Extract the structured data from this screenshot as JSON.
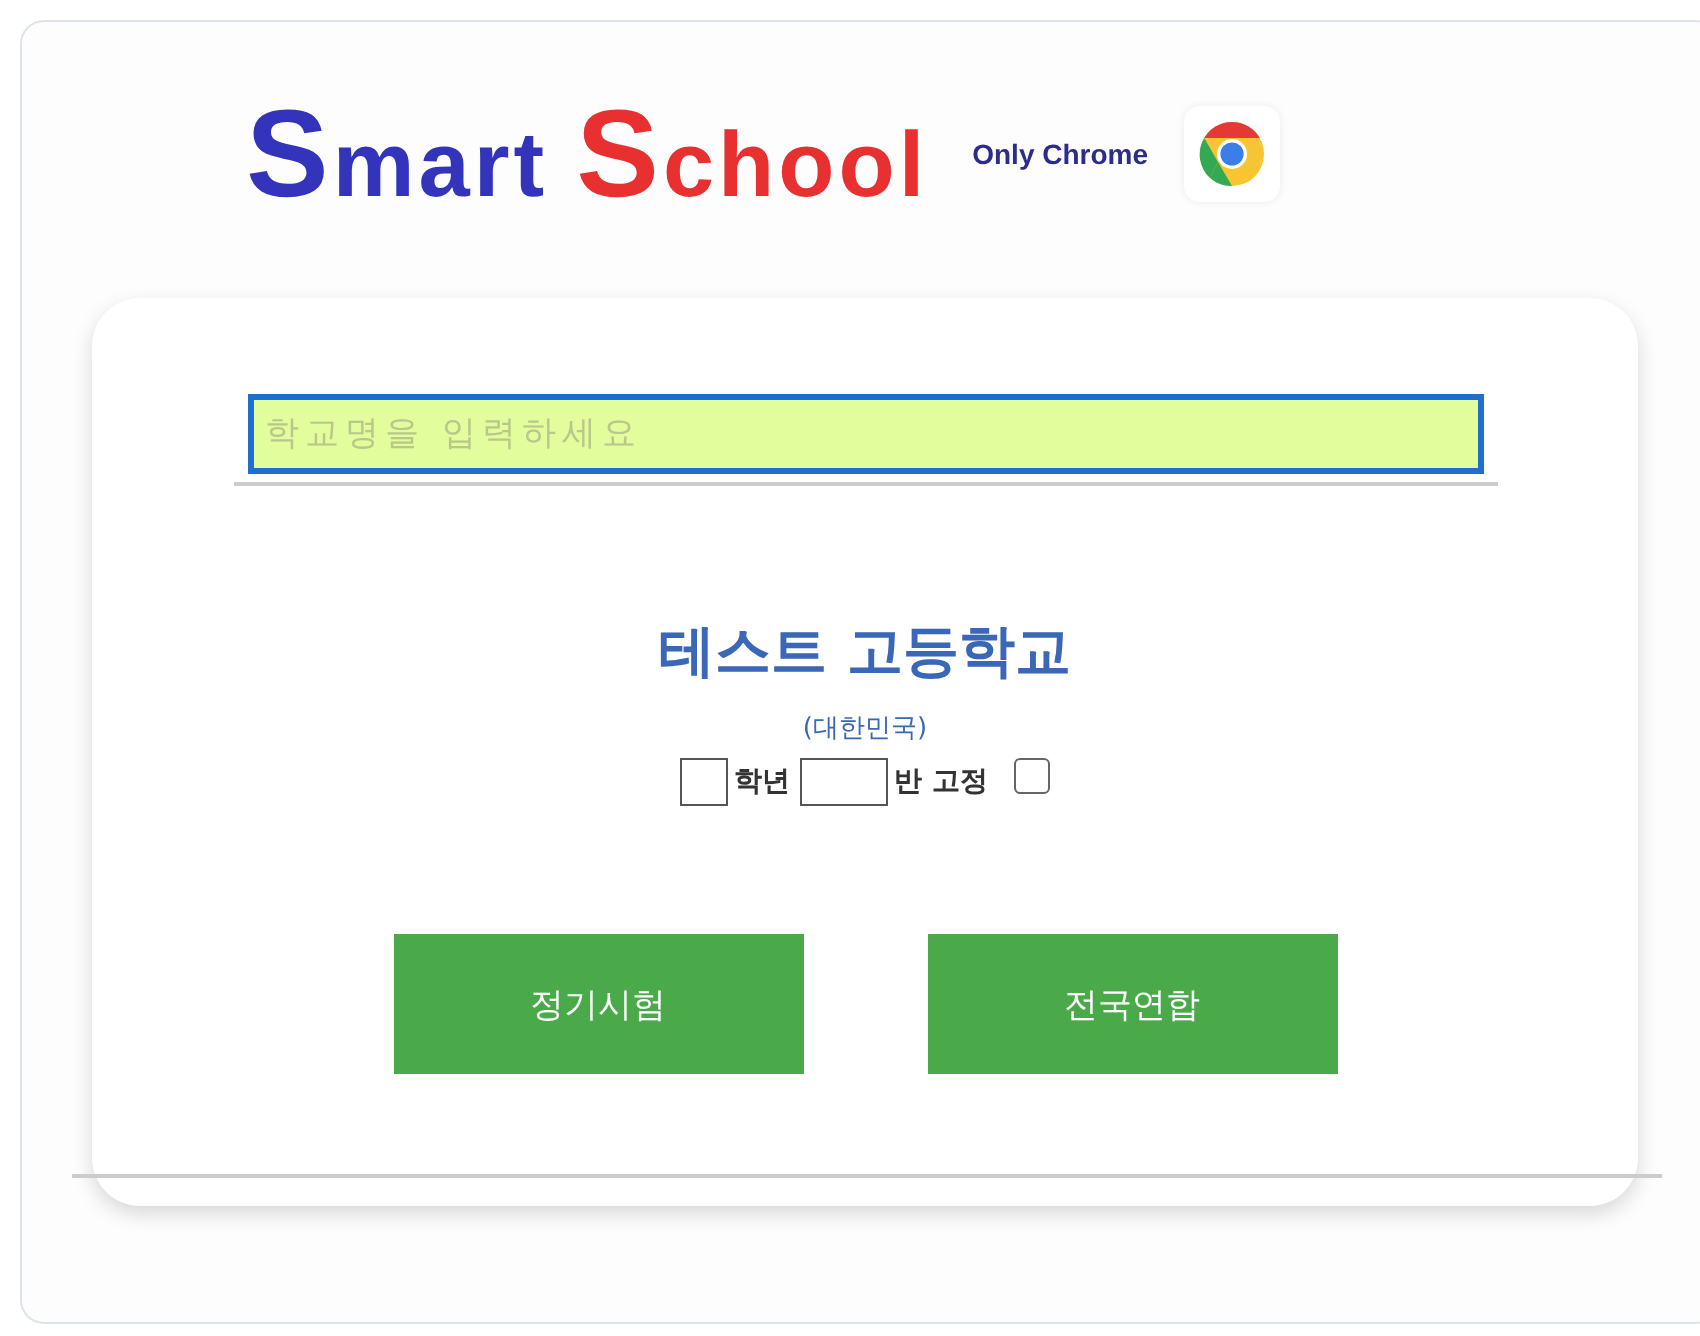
{
  "logo": {
    "first_initial": "S",
    "first_rest": "mart",
    "second_initial": "S",
    "second_rest": "chool"
  },
  "browser_note": "Only Chrome",
  "search": {
    "placeholder": "학교명을 입력하세요"
  },
  "school": {
    "name": "테스트 고등학교",
    "country": "(대한민국)"
  },
  "class_form": {
    "grade_label": "학년",
    "class_label": "반 고정",
    "fixed": {
      "checked": false
    }
  },
  "buttons": [
    {
      "label": "정기시험"
    },
    {
      "label": "전국연합"
    }
  ]
}
